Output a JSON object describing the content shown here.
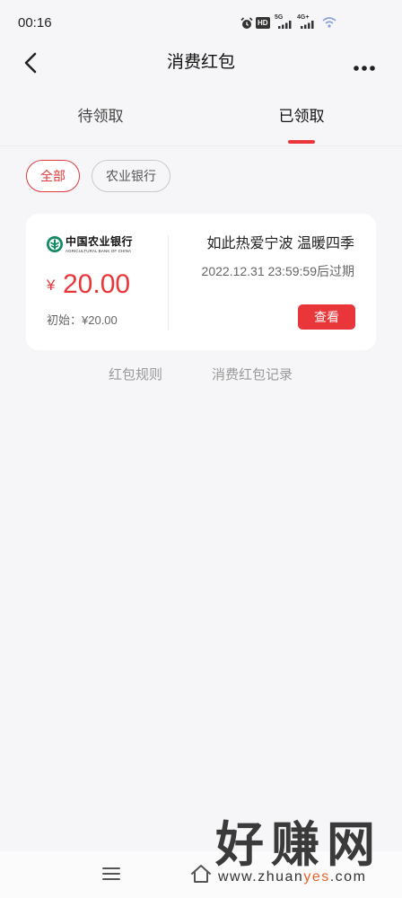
{
  "status_bar": {
    "time": "00:16",
    "hd_label": "HD",
    "network_1": "5G",
    "network_2": "4G+",
    "icons": [
      "alarm-icon",
      "hd-voice-icon",
      "signal-5g-icon",
      "signal-4g-icon",
      "wifi-icon"
    ]
  },
  "header": {
    "title": "消费红包",
    "back_icon": "chevron-left-icon",
    "more_icon": "more-dots-icon"
  },
  "tabs": [
    {
      "label": "待领取",
      "active": false
    },
    {
      "label": "已领取",
      "active": true
    }
  ],
  "filters": [
    {
      "label": "全部",
      "selected": true
    },
    {
      "label": "农业银行",
      "selected": false
    }
  ],
  "coupon_card": {
    "bank_logo": {
      "icon": "abc-bank-logo",
      "name_cn": "中国农业银行",
      "name_en": "AGRICULTURAL BANK OF CHINA"
    },
    "currency_symbol": "¥",
    "amount": "20.00",
    "initial_amount": "初始：¥20.00",
    "campaign_title": "如此热爱宁波 温暖四季",
    "expiry": "2022.12.31 23:59:59后过期",
    "action_label": "查看"
  },
  "footer_links": {
    "rules": "红包规则",
    "records": "消费红包记录"
  },
  "bottom_nav": {
    "icons": [
      "menu-icon",
      "home-icon"
    ]
  },
  "watermark": {
    "text": "好赚网",
    "url_prefix": "www.zhuan",
    "url_highlight": "yes",
    "url_suffix": ".com"
  },
  "colors": {
    "accent": "#e8363a",
    "bank_green": "#0e8a5f",
    "page_background": "#f6f6f8",
    "card_background": "#ffffff"
  }
}
